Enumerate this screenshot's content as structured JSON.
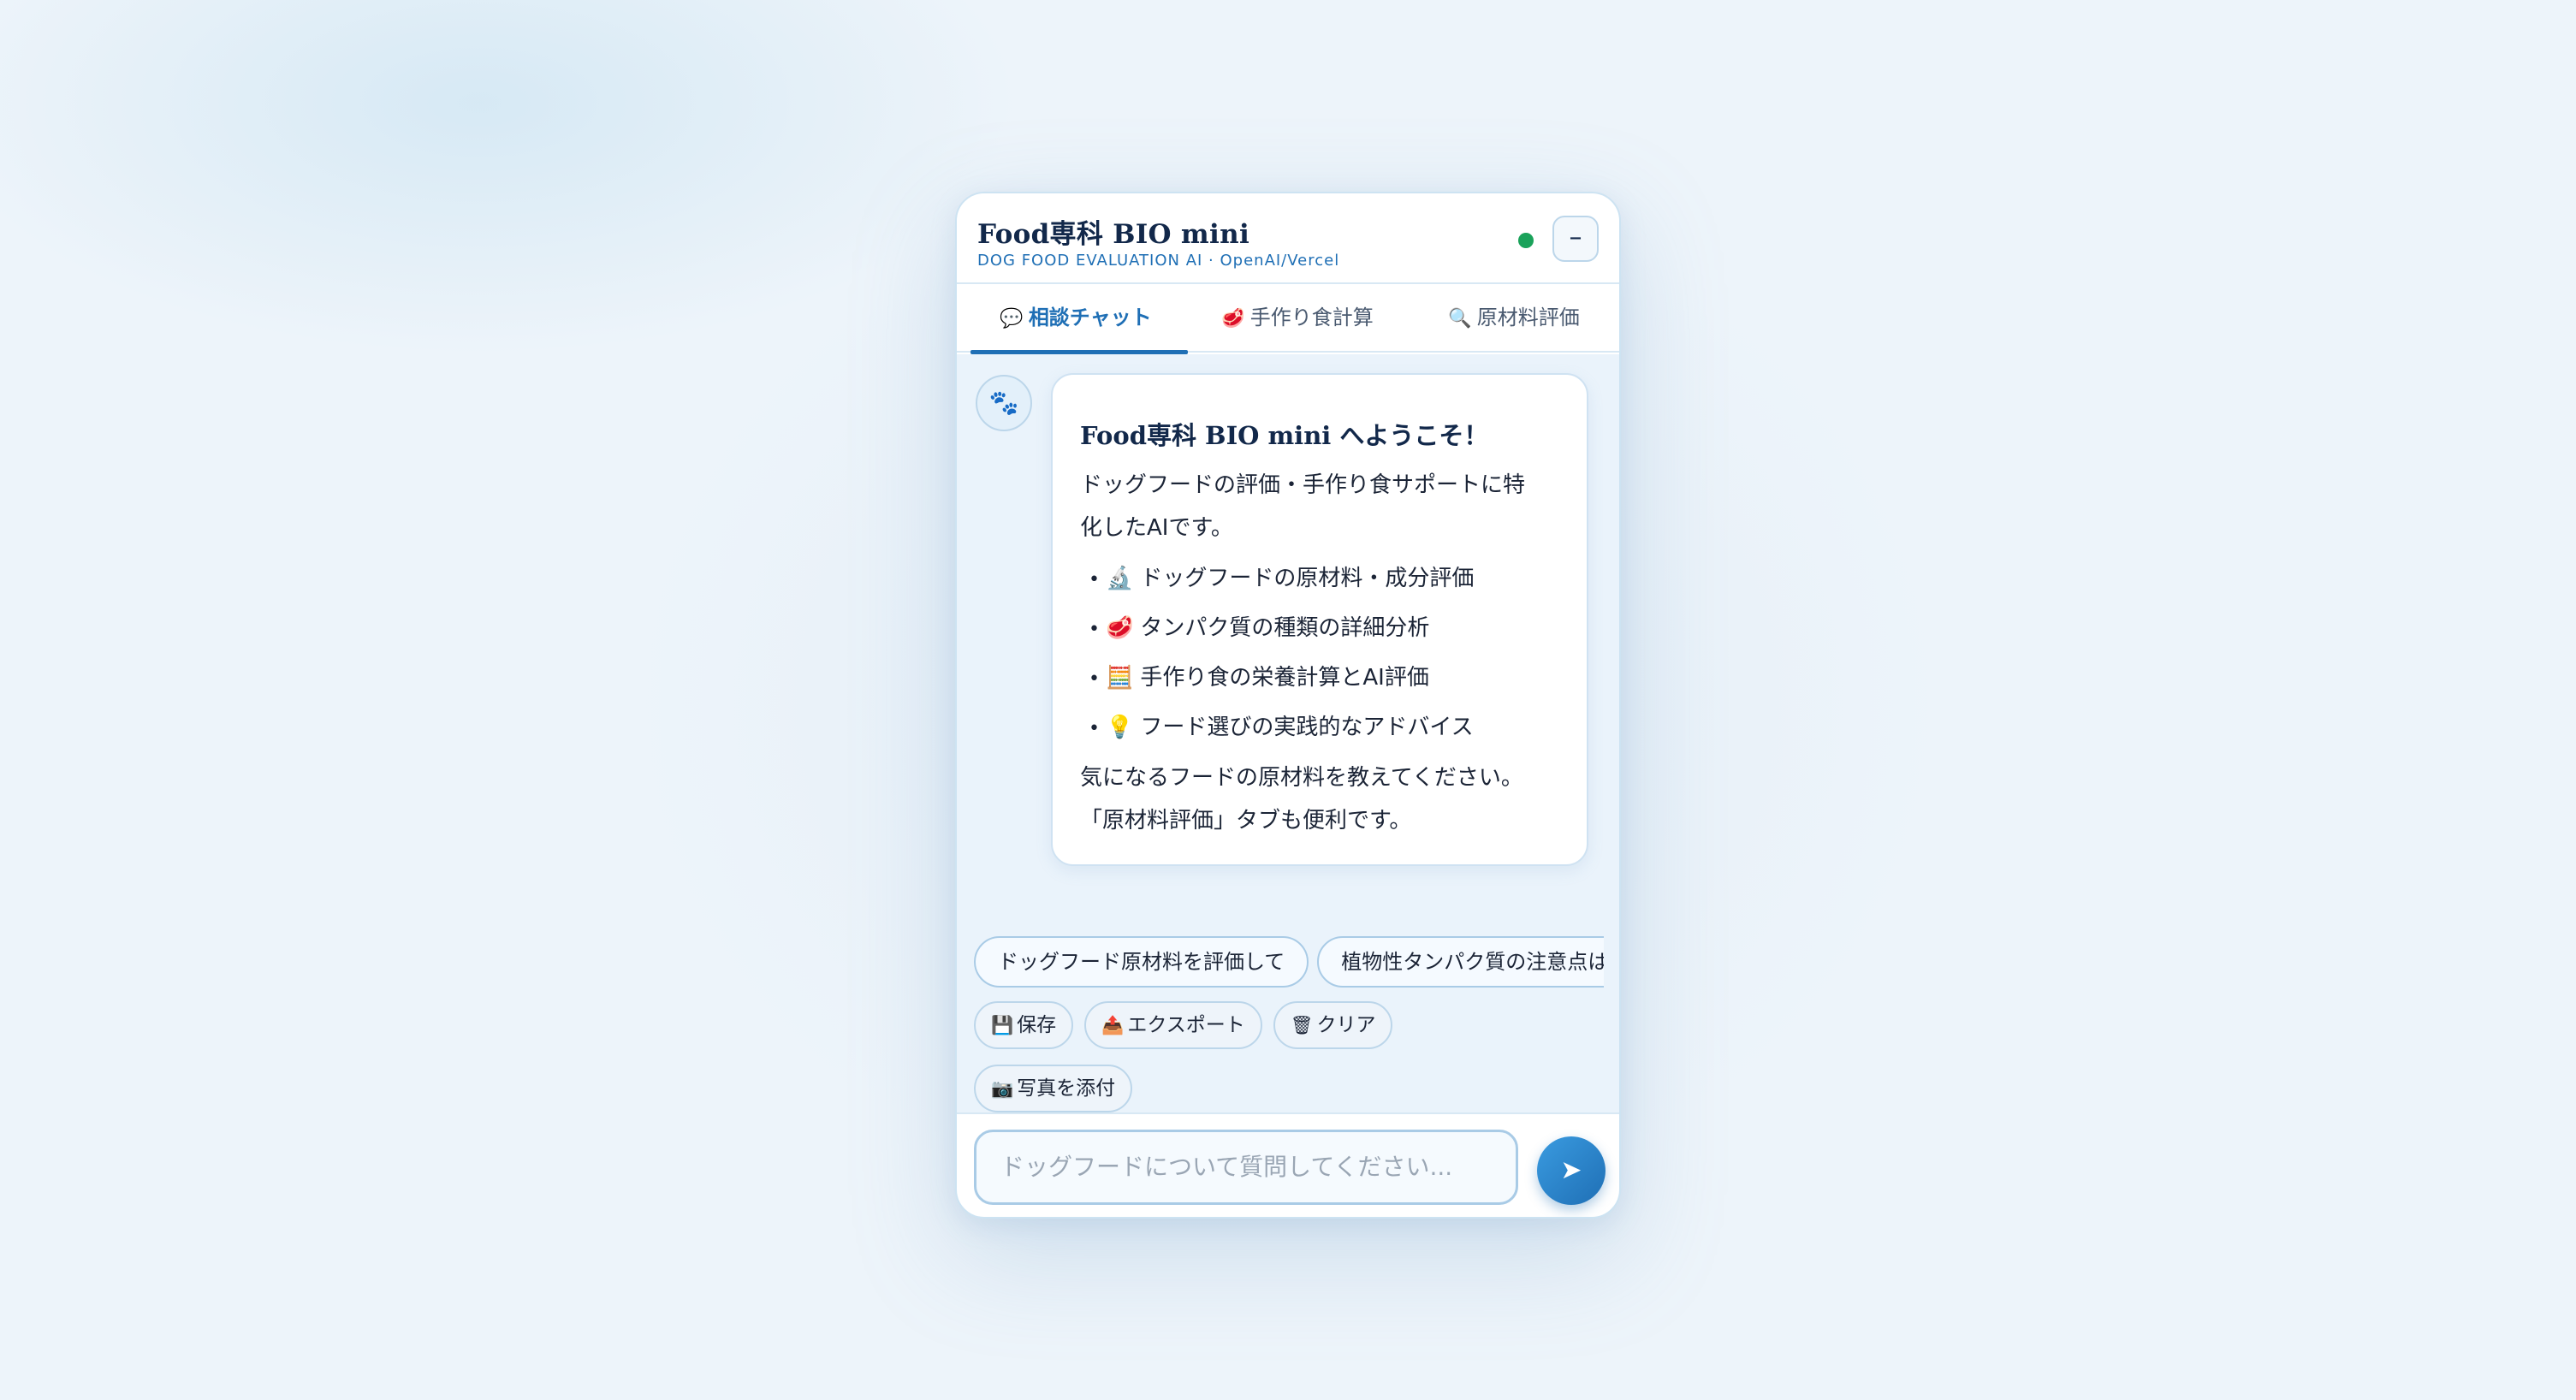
{
  "header": {
    "title": "Food専科 BIO mini",
    "subtitle": "DOG FOOD EVALUATION AI · OpenAI/Vercel",
    "status_color": "#1aa25a",
    "minimize_label": "–"
  },
  "tabs": [
    {
      "icon": "💬",
      "label": "相談チャット",
      "active": true
    },
    {
      "icon": "🥩",
      "label": "手作り食計算",
      "active": false
    },
    {
      "icon": "🔍",
      "label": "原材料評価",
      "active": false
    }
  ],
  "message": {
    "avatar": "🐾",
    "welcome": "Food専科 BIO mini へようこそ！",
    "intro_line1": "ドッグフードの評価・手作り食サポートに特",
    "intro_line2": "化したAIです。",
    "items": [
      {
        "icon": "🔬",
        "text": "ドッグフードの原材料・成分評価"
      },
      {
        "icon": "🥩",
        "text": "タンパク質の種類の詳細分析"
      },
      {
        "icon": "🧮",
        "text": "手作り食の栄養計算とAI評価"
      },
      {
        "icon": "💡",
        "text": "フード選びの実践的なアドバイス"
      }
    ],
    "outro_line1": "気になるフードの原材料を教えてください。",
    "outro_line2": "「原材料評価」タブも便利です。"
  },
  "suggestions": [
    "ドッグフード原材料を評価して",
    "植物性タンパク質の注意点は"
  ],
  "actions": [
    {
      "icon": "💾",
      "label": "保存"
    },
    {
      "icon": "📤",
      "label": "エクスポート"
    },
    {
      "icon": "🗑",
      "label": "クリア"
    }
  ],
  "attach": {
    "icon": "📷",
    "label": "写真を添付"
  },
  "input": {
    "placeholder": "ドッグフードについて質問してください..."
  },
  "send": {
    "icon": "➤"
  },
  "colors": {
    "accent": "#1f6fb5",
    "title": "#12284a",
    "background": "#edf4fa"
  }
}
